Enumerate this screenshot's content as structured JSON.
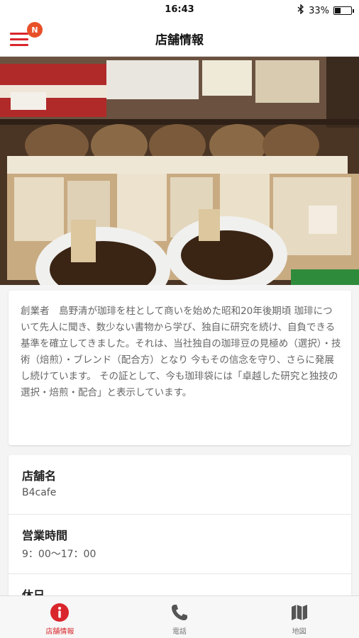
{
  "status_bar": {
    "time": "16:43",
    "battery": "33%",
    "battery_level": 0.33
  },
  "header": {
    "title": "店舗情報",
    "notification_badge": "N"
  },
  "description": "創業者　島野清が珈琲を柱として商いを始めた昭和20年後期頃 珈琲について先人に聞き、数少ない書物から学び、独自に研究を続け、自負できる基準を確立してきました。それは、当社独自の珈琲豆の見極め（選択）・技術（焙煎）・ブレンド（配合方）となり 今もその信念を守り、さらに発展し続けています。 その証として、今も珈琲袋には「卓越した研究と独技の選択・焙煎・配合」と表示しています。",
  "info": {
    "rows": [
      {
        "label": "店舗名",
        "value": "B4cafe"
      },
      {
        "label": "営業時間",
        "value": "9：00～17：00"
      },
      {
        "label": "休日",
        "value": ""
      }
    ]
  },
  "tabs": [
    {
      "label": "店舗情報",
      "icon": "info-icon",
      "active": true
    },
    {
      "label": "電話",
      "icon": "phone-icon",
      "active": false
    },
    {
      "label": "地図",
      "icon": "map-icon",
      "active": false
    }
  ],
  "colors": {
    "accent": "#d9262c",
    "badge": "#e8502a"
  }
}
